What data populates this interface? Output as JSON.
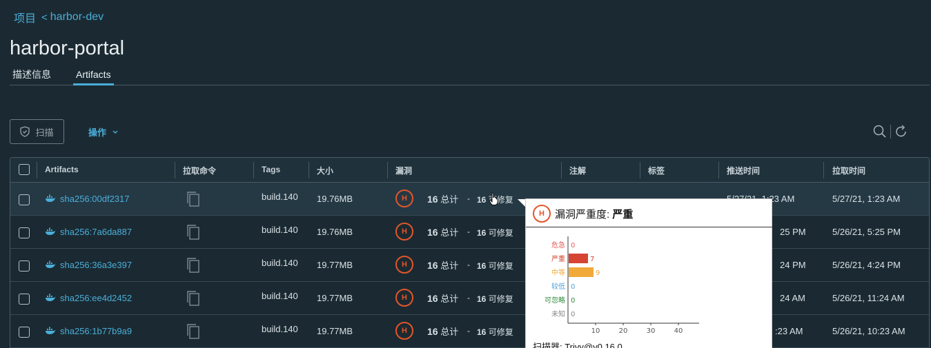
{
  "breadcrumb": {
    "project": "项目",
    "separator": "<",
    "repo": "harbor-dev"
  },
  "page_title": "harbor-portal",
  "tabs": [
    {
      "label": "描述信息"
    },
    {
      "label": "Artifacts"
    }
  ],
  "toolbar": {
    "scan_label": "扫描",
    "actions_label": "操作"
  },
  "table": {
    "columns": [
      "Artifacts",
      "拉取命令",
      "Tags",
      "大小",
      "漏洞",
      "注解",
      "标签",
      "推送时间",
      "拉取时间"
    ],
    "rows": [
      {
        "digest": "sha256:00df2317",
        "tag": "build.140",
        "size": "19.76MB",
        "severity": "H",
        "total": "16",
        "total_label": "总计",
        "dash": "-",
        "fixable": "16",
        "fixable_label": "可修复",
        "push_time": "5/27/21, 1:23 AM",
        "pull_time": "5/27/21, 1:23 AM"
      },
      {
        "digest": "sha256:7a6da887",
        "tag": "build.140",
        "size": "19.76MB",
        "severity": "H",
        "total": "16",
        "total_label": "总计",
        "dash": "-",
        "fixable": "16",
        "fixable_label": "可修复",
        "push_time": "25 PM",
        "pull_time": "5/26/21, 5:25 PM"
      },
      {
        "digest": "sha256:36a3e397",
        "tag": "build.140",
        "size": "19.77MB",
        "severity": "H",
        "total": "16",
        "total_label": "总计",
        "dash": "-",
        "fixable": "16",
        "fixable_label": "可修复",
        "push_time": "24 PM",
        "pull_time": "5/26/21, 4:24 PM"
      },
      {
        "digest": "sha256:ee4d2452",
        "tag": "build.140",
        "size": "19.77MB",
        "severity": "H",
        "total": "16",
        "total_label": "总计",
        "dash": "-",
        "fixable": "16",
        "fixable_label": "可修复",
        "push_time": "24 AM",
        "pull_time": "5/26/21, 11:24 AM"
      },
      {
        "digest": "sha256:1b77b9a9",
        "tag": "build.140",
        "size": "19.77MB",
        "severity": "H",
        "total": "16",
        "total_label": "总计",
        "dash": "-",
        "fixable": "16",
        "fixable_label": "可修复",
        "push_time": ":23 AM",
        "pull_time": "5/26/21, 10:23 AM"
      }
    ]
  },
  "popover": {
    "title_prefix": "漏洞严重度: ",
    "title_value": "严重",
    "scanner": "扫描器: Trivy@v0.16.0"
  },
  "chart_data": {
    "type": "bar",
    "orientation": "horizontal",
    "categories": [
      "危急",
      "严重",
      "中等",
      "较低",
      "可忽略",
      "未知"
    ],
    "values": [
      0,
      7,
      9,
      0,
      0,
      0
    ],
    "category_colors": [
      "#e35b5b",
      "#d64533",
      "#f1a93a",
      "#4f9fdc",
      "#2e8b3a",
      "#888888"
    ],
    "xticks": [
      "10",
      "20",
      "30",
      "40"
    ],
    "xlim": [
      0,
      45
    ]
  },
  "colors": {
    "accent": "#49afd9",
    "high": "#e2562b",
    "background": "#1b2a32"
  }
}
